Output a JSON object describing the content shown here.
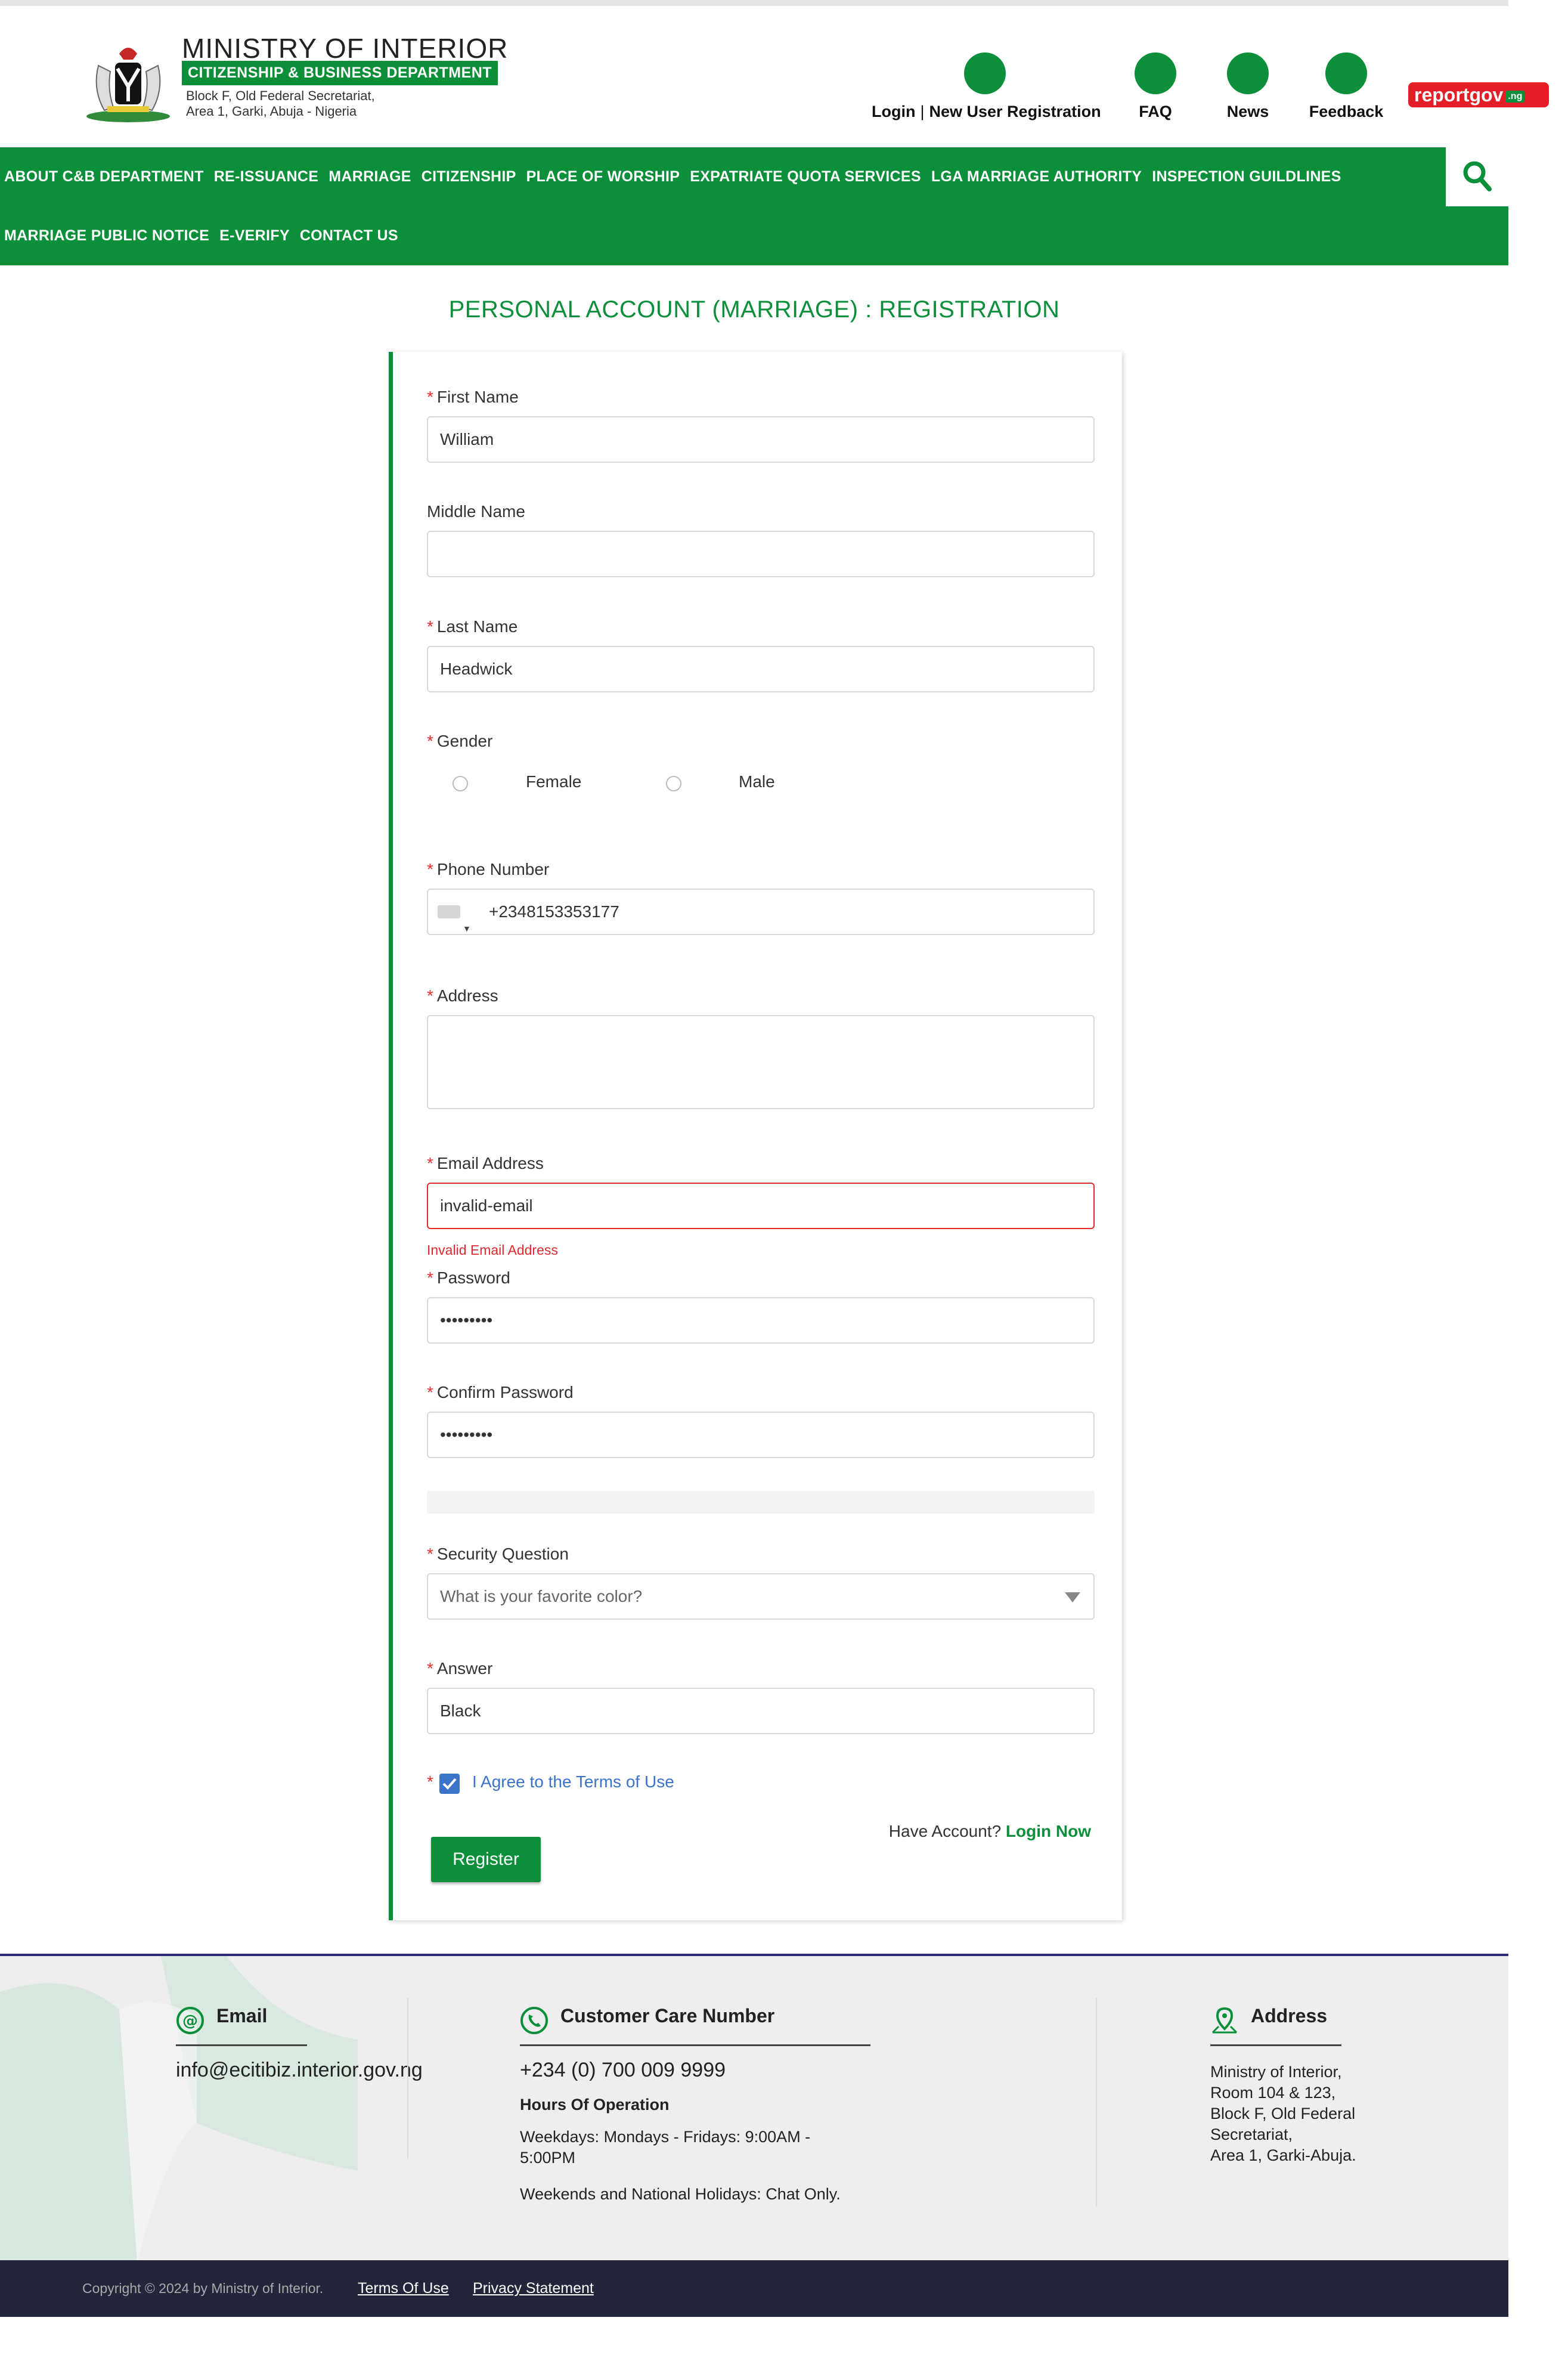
{
  "header": {
    "ministry_title": "MINISTRY OF INTERIOR",
    "department": "CITIZENSHIP & BUSINESS DEPARTMENT",
    "address_line1": "Block F, Old Federal Secretariat,",
    "address_line2": "Area 1, Garki, Abuja - Nigeria",
    "login_label": "Login",
    "separator": "|",
    "register_label": "New User Registration",
    "faq_label": "FAQ",
    "news_label": "News",
    "feedback_label": "Feedback",
    "reportgov_label": "reportgov",
    "reportgov_tld": ".ng",
    "brand_color": "#0b8f3a"
  },
  "nav": {
    "row1": [
      "ABOUT C&B DEPARTMENT",
      "RE-ISSUANCE",
      "MARRIAGE",
      "CITIZENSHIP",
      "PLACE OF WORSHIP",
      "EXPATRIATE QUOTA SERVICES",
      "LGA MARRIAGE AUTHORITY",
      "INSPECTION GUILDLINES"
    ],
    "row2": [
      "MARRIAGE PUBLIC NOTICE",
      "E-VERIFY",
      "CONTACT US"
    ],
    "search_icon": "search-icon"
  },
  "page_title": "PERSONAL ACCOUNT (MARRIAGE) : REGISTRATION",
  "form": {
    "required_mark": "*",
    "first_name": {
      "label": "First Name",
      "value": "William"
    },
    "middle_name": {
      "label": "Middle Name",
      "value": ""
    },
    "last_name": {
      "label": "Last Name",
      "value": "Headwick"
    },
    "gender": {
      "label": "Gender",
      "options": [
        "Female",
        "Male"
      ]
    },
    "phone": {
      "label": "Phone Number",
      "value": "+2348153353177"
    },
    "address": {
      "label": "Address",
      "value": ""
    },
    "email": {
      "label": "Email Address",
      "value": "invalid-email",
      "error": "Invalid Email Address"
    },
    "password": {
      "label": "Password",
      "value": "•••••••••"
    },
    "confirm_password": {
      "label": "Confirm Password",
      "value": "•••••••••"
    },
    "security_question": {
      "label": "Security Question",
      "value": "What is your favorite color?"
    },
    "answer": {
      "label": "Answer",
      "value": "Black"
    },
    "terms": {
      "label": "I Agree to the Terms of Use",
      "checked": true
    },
    "have_account": "Have Account?",
    "login_now": "Login Now",
    "register_button": "Register"
  },
  "footer": {
    "email": {
      "heading": "Email",
      "value": "info@ecitibiz.interior.gov.ng"
    },
    "customer_care": {
      "heading": "Customer Care Number",
      "phone": "+234 (0) 700 009 9999",
      "hours_heading": "Hours Of Operation",
      "weekdays": "Weekdays: Mondays - Fridays: 9:00AM - 5:00PM",
      "weekends": "Weekends and National Holidays: Chat Only."
    },
    "address": {
      "heading": "Address",
      "lines": [
        "Ministry of Interior,",
        "Room 104 & 123,",
        "Block F, Old Federal",
        "Secretariat,",
        "Area 1, Garki-Abuja."
      ]
    },
    "copyright": "Copyright © 2024 by Ministry of Interior.",
    "terms_link": "Terms Of Use",
    "privacy_link": "Privacy Statement"
  }
}
